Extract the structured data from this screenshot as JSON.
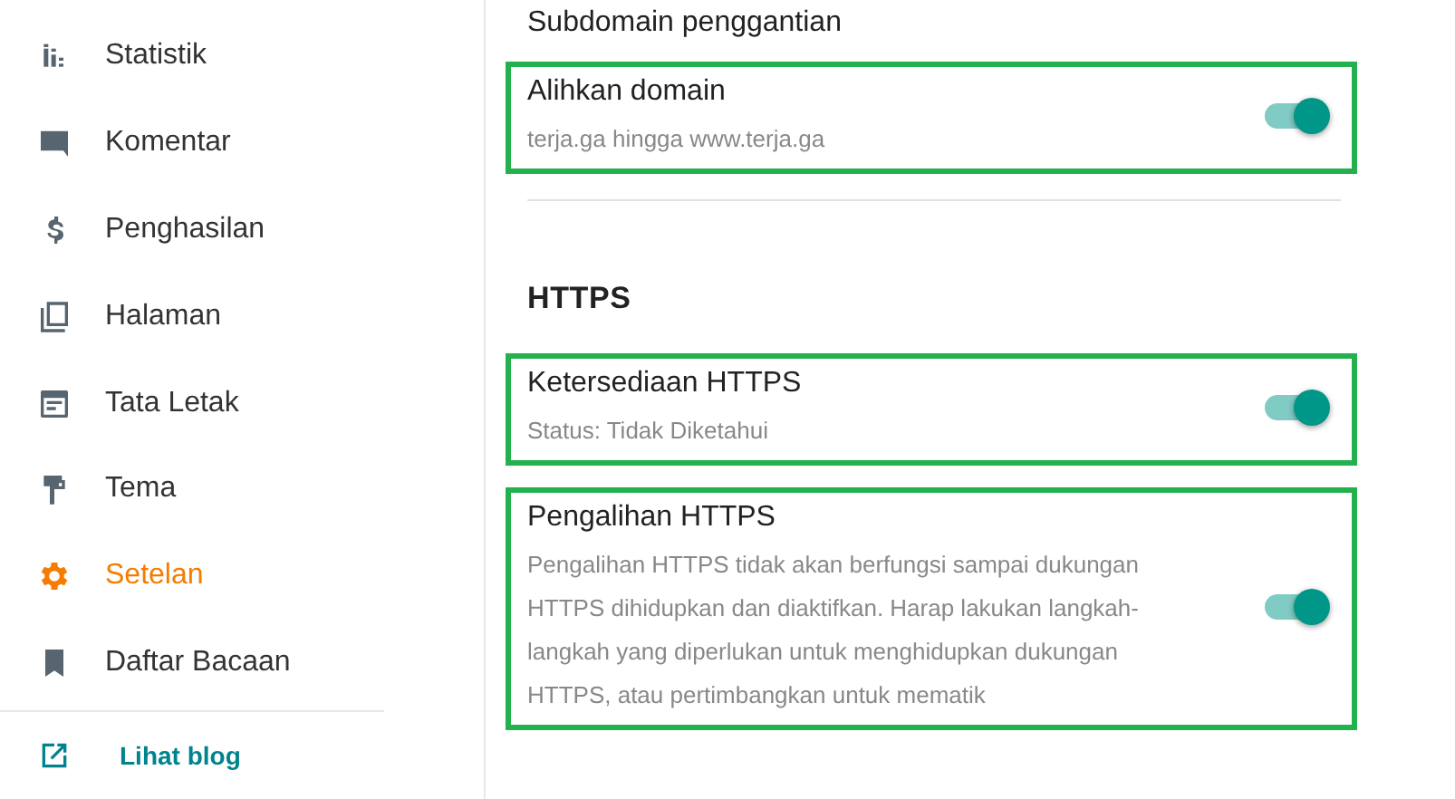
{
  "sidebar": {
    "items": [
      {
        "label": "Statistik",
        "selected": false
      },
      {
        "label": "Komentar",
        "selected": false
      },
      {
        "label": "Penghasilan",
        "selected": false
      },
      {
        "label": "Halaman",
        "selected": false
      },
      {
        "label": "Tata Letak",
        "selected": false
      },
      {
        "label": "Tema",
        "selected": false
      },
      {
        "label": "Setelan",
        "selected": true
      },
      {
        "label": "Daftar Bacaan",
        "selected": false
      }
    ],
    "view_blog_link": "Lihat blog"
  },
  "main": {
    "top_label": "Subdomain penggantian",
    "sections": [
      {
        "settings": [
          {
            "title": "Alihkan domain",
            "description": "terja.ga hingga www.terja.ga",
            "on": true,
            "highlighted": true
          }
        ]
      },
      {
        "heading": "HTTPS",
        "settings": [
          {
            "title": "Ketersediaan HTTPS",
            "description": "Status: Tidak Diketahui",
            "on": true,
            "highlighted": true
          },
          {
            "title": "Pengalihan HTTPS",
            "description": "Pengalihan HTTPS tidak akan berfungsi sampai dukungan HTTPS dihidupkan dan diaktifkan. Harap lakukan langkah-langkah yang diperlukan untuk menghidupkan dukungan HTTPS, atau pertimbangkan untuk mematik",
            "on": true,
            "highlighted": true
          }
        ]
      }
    ]
  }
}
